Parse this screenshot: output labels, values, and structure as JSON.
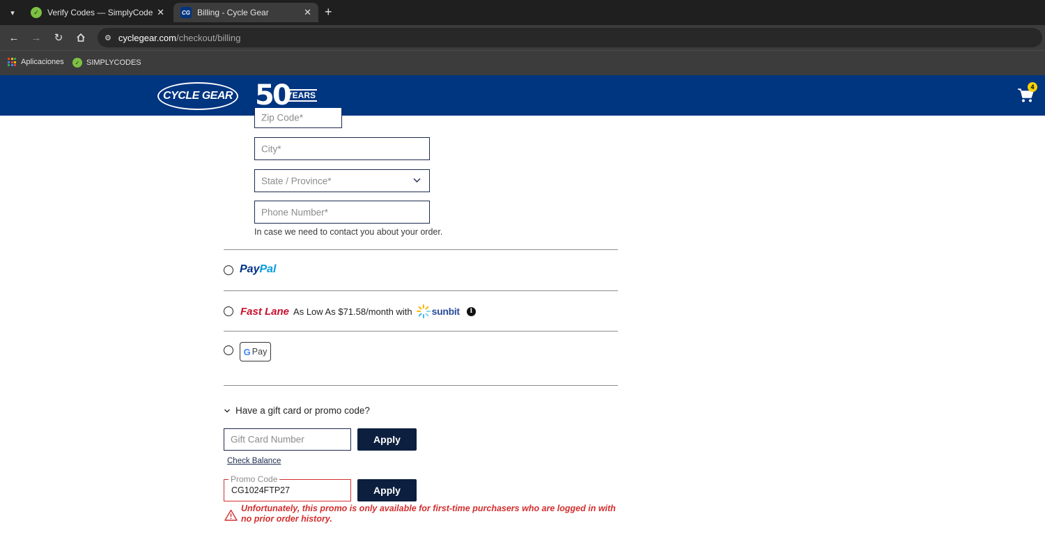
{
  "browser": {
    "tabs": [
      {
        "title": "Verify Codes — SimplyCodes",
        "favicon": "simplycodes-icon",
        "active": false
      },
      {
        "title": "Billing - Cycle Gear",
        "favicon": "cyclegear-icon",
        "active": true
      }
    ],
    "url_host": "cyclegear.com",
    "url_path": "/checkout/billing",
    "bookmarks": [
      {
        "label": "Aplicaciones",
        "icon": "apps-grid-icon"
      },
      {
        "label": "SIMPLYCODES",
        "icon": "simplycodes-icon"
      }
    ]
  },
  "header": {
    "logo_text": "CYCLE GEAR",
    "anniversary_number": "50",
    "anniversary_word": "YEARS",
    "cart_count": "4",
    "brand_color": "#003580"
  },
  "form": {
    "zip_placeholder": "Zip Code*",
    "city_placeholder": "City*",
    "state_placeholder": "State / Province*",
    "phone_placeholder": "Phone Number*",
    "phone_helper": "In case we need to contact you about your order."
  },
  "payment": {
    "paypal_pay": "Pay",
    "paypal_pal": "Pal",
    "fastlane_label": "Fast Lane",
    "fastlane_text": "As Low As $71.58/month with",
    "sunbit_label": "sunbit",
    "gpay_g": "G",
    "gpay_label": "Pay"
  },
  "promo": {
    "toggle_label": "Have a gift card or promo code?",
    "gift_card_placeholder": "Gift Card Number",
    "apply_label": "Apply",
    "check_balance_label": "Check Balance",
    "promo_label": "Promo Code",
    "promo_value": "CG1024FTP27",
    "error_message": "Unfortunately, this promo is only available for first-time purchasers who are logged in with no prior order history.",
    "error_color": "#d32f2f"
  }
}
